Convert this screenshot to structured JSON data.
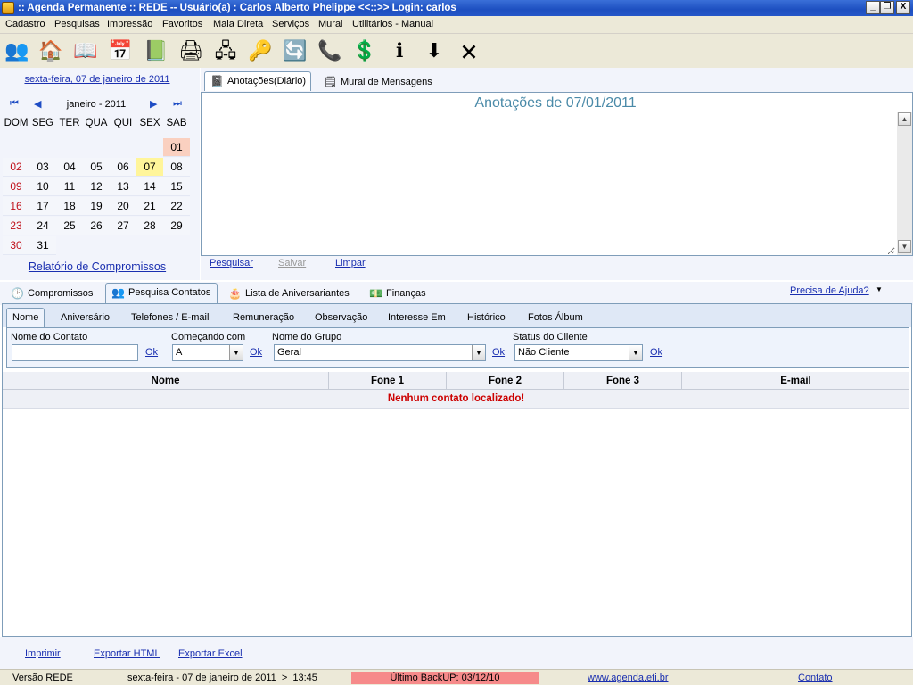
{
  "window": {
    "title": ":: Agenda Permanente :: REDE -- Usuário(a) : Carlos Alberto Phelippe <<::>> Login: carlos",
    "minimize": "_",
    "restore": "❐",
    "close": "X"
  },
  "menu": [
    "Cadastro",
    "Pesquisas",
    "Impressão",
    "Favoritos",
    "Mala Direta",
    "Serviços",
    "Mural",
    "Utilitários - Manual"
  ],
  "toolbar": [
    {
      "icon": "users-icon",
      "glyph": "👥"
    },
    {
      "icon": "home-icon",
      "glyph": "🏠"
    },
    {
      "icon": "address-book-icon",
      "glyph": "📖"
    },
    {
      "icon": "calendar-icon",
      "glyph": "📅"
    },
    {
      "icon": "notebook-icon",
      "glyph": "📗"
    },
    {
      "icon": "printer-icon",
      "glyph": "🖨"
    },
    {
      "icon": "network-icon",
      "glyph": "🖧"
    },
    {
      "icon": "key-icon",
      "glyph": "🔑"
    },
    {
      "icon": "sync-icon",
      "glyph": "🔄"
    },
    {
      "icon": "phone-icon",
      "glyph": "📞"
    },
    {
      "icon": "money-icon",
      "glyph": "💲"
    },
    {
      "icon": "info-icon",
      "glyph": "ℹ"
    },
    {
      "icon": "download-icon",
      "glyph": "⬇"
    },
    {
      "icon": "exit-icon",
      "glyph": "🗙"
    }
  ],
  "calendar": {
    "date_link": "sexta-feira, 07 de janeiro de 2011",
    "month_label": "janeiro - 2011",
    "nav": {
      "first": "⏮",
      "prev": "◀",
      "next": "▶",
      "last": "⏭"
    },
    "weekdays": [
      "DOM",
      "SEG",
      "TER",
      "QUA",
      "QUI",
      "SEX",
      "SAB"
    ],
    "weeks": [
      [
        "",
        "",
        "",
        "",
        "",
        "",
        "01"
      ],
      [
        "02",
        "03",
        "04",
        "05",
        "06",
        "07",
        "08"
      ],
      [
        "09",
        "10",
        "11",
        "12",
        "13",
        "14",
        "15"
      ],
      [
        "16",
        "17",
        "18",
        "19",
        "20",
        "21",
        "22"
      ],
      [
        "23",
        "24",
        "25",
        "26",
        "27",
        "28",
        "29"
      ],
      [
        "30",
        "31",
        "",
        "",
        "",
        "",
        ""
      ]
    ],
    "today": "07",
    "report_link": "Relatório de Compromissos"
  },
  "notes_tabs": [
    {
      "label": "Anotações(Diário)",
      "icon": "diary-icon",
      "glyph": "📓",
      "active": true
    },
    {
      "label": "Mural de Mensagens",
      "icon": "messages-icon",
      "glyph": "🗒",
      "active": false
    }
  ],
  "notes": {
    "title": "Anotações de 07/01/2011",
    "text": "",
    "search": "Pesquisar",
    "save": "Salvar",
    "clear": "Limpar"
  },
  "bottom_tabs": [
    {
      "label": "Compromissos",
      "icon": "clock-icon",
      "glyph": "🕑",
      "active": false
    },
    {
      "label": "Pesquisa Contatos",
      "icon": "contacts-icon",
      "glyph": "👥",
      "active": true
    },
    {
      "label": "Lista de Aniversariantes",
      "icon": "birthday-icon",
      "glyph": "🎂",
      "active": false
    },
    {
      "label": "Finanças",
      "icon": "finance-icon",
      "glyph": "💵",
      "active": false
    }
  ],
  "help_link": "Precisa de Ajuda?",
  "contact_subtabs": [
    "Nome",
    "Aniversário",
    "Telefones / E-mail",
    "Remuneração",
    "Observação",
    "Interesse Em",
    "Histórico",
    "Fotos Álbum"
  ],
  "filters": {
    "name_label": "Nome do Contato",
    "name_value": "",
    "starting_label": "Começando com",
    "starting_value": "A",
    "group_label": "Nome do Grupo",
    "group_value": "Geral",
    "status_label": "Status do Cliente",
    "status_value": "Não Cliente",
    "ok": "Ok"
  },
  "grid": {
    "columns": [
      "Nome",
      "Fone 1",
      "Fone 2",
      "Fone 3",
      "E-mail"
    ],
    "empty_message": "Nenhum contato localizado!"
  },
  "export": {
    "print": "Imprimir",
    "html": "Exportar HTML",
    "excel": "Exportar Excel"
  },
  "status": {
    "version": "Versão REDE",
    "datetime": "sexta-feira - 07 de janeiro de 2011  >  13:45",
    "backup": "Último BackUP: 03/12/10",
    "site": "www.agenda.eti.br",
    "contact": "Contato"
  }
}
